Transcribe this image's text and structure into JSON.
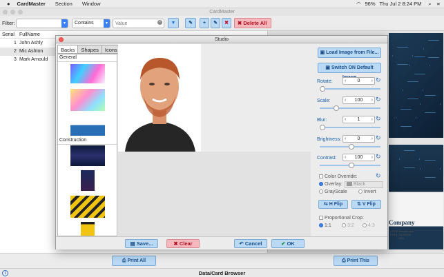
{
  "menubar": {
    "app": "CardMaster",
    "items": [
      "Section",
      "Window"
    ],
    "battery": "96%",
    "clock": "Thu Jul 2  8:24 PM"
  },
  "window": {
    "title": "CardMaster"
  },
  "toolbar": {
    "filter_label": "Filter:",
    "filter_value": "",
    "operator": "Contains",
    "value_placeholder": "Value",
    "delete_all": "Delete All"
  },
  "table": {
    "headers": [
      "Serial",
      "FullName"
    ],
    "rows": [
      {
        "serial": "1",
        "name": "John Ashly"
      },
      {
        "serial": "2",
        "name": "Mic Ashton"
      },
      {
        "serial": "3",
        "name": "Mark Arnould"
      }
    ]
  },
  "card_preview": {
    "company": "Company",
    "address_lines": [
      "375 N Western Ave",
      "ELES, CA 90004",
      "USA"
    ]
  },
  "studio": {
    "title": "Studio",
    "tabs": [
      "Backs",
      "Shapes",
      "Icons"
    ],
    "sections": [
      "General",
      "Construction"
    ],
    "load_image": "Load Image from File...",
    "switch_default": "Switch ON Default Image",
    "rotate": {
      "label": "Rotate:",
      "value": "0"
    },
    "scale": {
      "label": "Scale:",
      "value": "100"
    },
    "blur": {
      "label": "Blur:",
      "value": "1"
    },
    "brightness": {
      "label": "Brightness:",
      "value": "0"
    },
    "contrast": {
      "label": "Contrast:",
      "value": "100"
    },
    "color_override": "Color Override:",
    "overlay": "Overlay:",
    "overlay_color": "Black",
    "grayscale": "GrayScale",
    "invert": "Invert",
    "hflip": "H Flip",
    "vflip": "V Flip",
    "proportional_crop": "Proportional Crop:",
    "crop_ratios": [
      "1:1",
      "3:2",
      "4:3"
    ],
    "save": "Save...",
    "clear": "Clear",
    "cancel": "Cancel",
    "ok": "OK"
  },
  "bottom": {
    "print_all": "Print All",
    "print_this": "Print This",
    "status": "Data/Card Browser"
  },
  "colors": {
    "accent": "#3b82f6",
    "danger": "#c8102e",
    "button_blue": "#b9d9f5"
  }
}
